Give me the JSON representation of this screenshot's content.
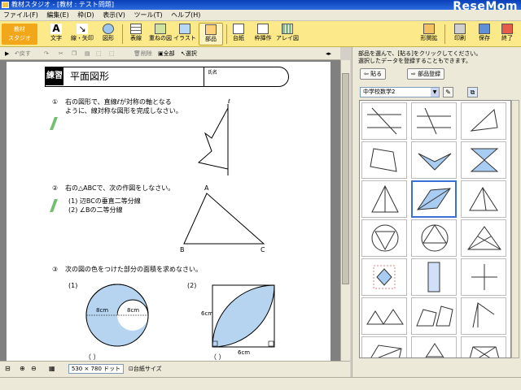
{
  "window": {
    "title": "教材スタジオ - [教材 : テスト問題]"
  },
  "brand": "ReseMom",
  "menu": [
    "ファイル(F)",
    "編集(E)",
    "枠(D)",
    "表示(V)",
    "ツール(T)",
    "ヘルプ(H)"
  ],
  "logo": {
    "line1": "教材",
    "line2": "スタジオ"
  },
  "toolbar": {
    "left": [
      "文字",
      "線・矢印",
      "図形",
      "表線",
      "重ねの図",
      "イラスト",
      "部品",
      "台紙",
      "枠挿作",
      "アレイ図"
    ],
    "right": [
      "形関拡",
      "印刷",
      "保存",
      "終了"
    ],
    "active": "部品"
  },
  "edit_toolbar": {
    "undo": "戻す",
    "delete": "削除",
    "all": "全部",
    "select": "選択"
  },
  "worksheet": {
    "badge": "練習",
    "title": "平面図形",
    "name_label": "氏名",
    "q1": {
      "num": "①",
      "line1": "右の図形で、直線ℓが対称の軸となる",
      "line2": "ように、線対称な図形を完成しなさい。",
      "axis": "ℓ"
    },
    "q2": {
      "num": "②",
      "line1": "右の△ABCで、次の作図をしなさい。",
      "sub1": "(1) 辺BCの垂直二等分線",
      "sub2": "(2) ∠Bの二等分線",
      "A": "A",
      "B": "B",
      "C": "C"
    },
    "q3": {
      "num": "③",
      "line1": "次の図の色をつけた部分の面積を求めなさい。",
      "p1": "(1)",
      "p2": "(2)",
      "d1": "8cm",
      "d2": "8cm",
      "s1": "6cm",
      "s2": "6cm"
    },
    "paren": "（          ）"
  },
  "doc_status": {
    "size": "530 × 780 ドット",
    "fit": "台紙サイズ"
  },
  "panel": {
    "hint_line1": "部品を選んで、[貼る]をクリックしてください。",
    "hint_line2": "選択したデータを登録することもできます。",
    "paste": "貼る",
    "register": "部品登録",
    "grade": "中学校数学2"
  }
}
